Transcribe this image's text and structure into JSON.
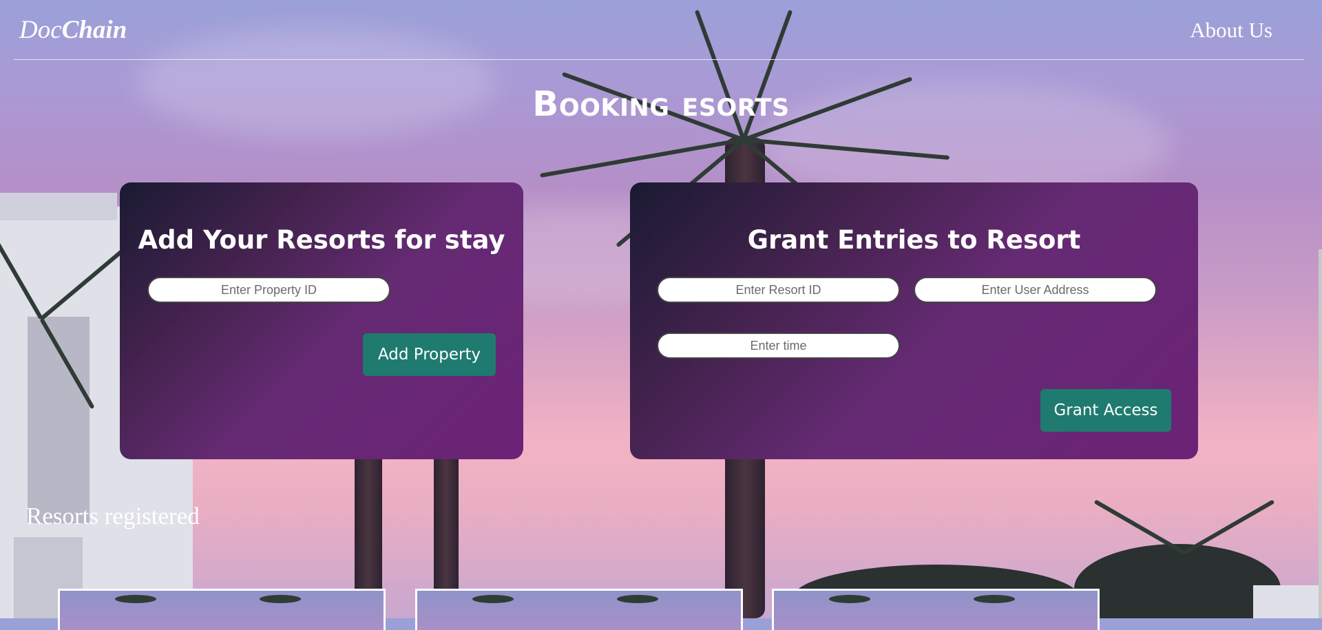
{
  "header": {
    "brand_prefix": "Doc",
    "brand_suffix": "Chain",
    "about_label": "About Us"
  },
  "page_title": "Booking esorts",
  "add_card": {
    "title": "Add Your Resorts for stay",
    "property_id_placeholder": "Enter Property ID",
    "button_label": "Add Property"
  },
  "grant_card": {
    "title": "Grant Entries to Resort",
    "resort_id_placeholder": "Enter Resort ID",
    "user_address_placeholder": "Enter User Address",
    "time_placeholder": "Enter time",
    "button_label": "Grant Access"
  },
  "resorts_section": {
    "title": "Resorts registered",
    "cards_visible": 3
  },
  "colors": {
    "accent_button": "#1f7a6f",
    "card_gradient_start": "#1a1a32",
    "card_gradient_end": "#6c2276"
  }
}
